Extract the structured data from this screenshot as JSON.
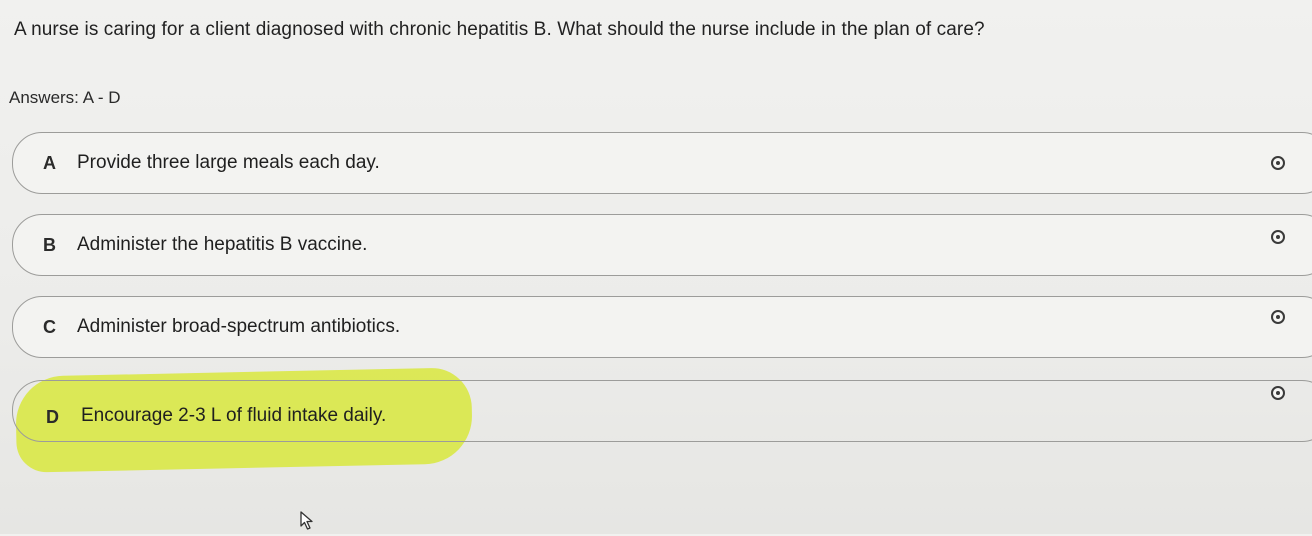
{
  "question": "A nurse is caring for a client diagnosed with chronic hepatitis B. What should the nurse include in the plan of care?",
  "answers_line": "Answers: A - D",
  "options": [
    {
      "letter": "A",
      "text": "Provide three large meals each day."
    },
    {
      "letter": "B",
      "text": "Administer the hepatitis B vaccine."
    },
    {
      "letter": "C",
      "text": "Administer broad-spectrum antibiotics."
    },
    {
      "letter": "D",
      "text": "Encourage 2-3 L of fluid intake daily."
    }
  ],
  "highlight_color": "#d6e81e",
  "icons": {
    "radio": "radio-button-icon",
    "cursor": "mouse-pointer-icon"
  }
}
